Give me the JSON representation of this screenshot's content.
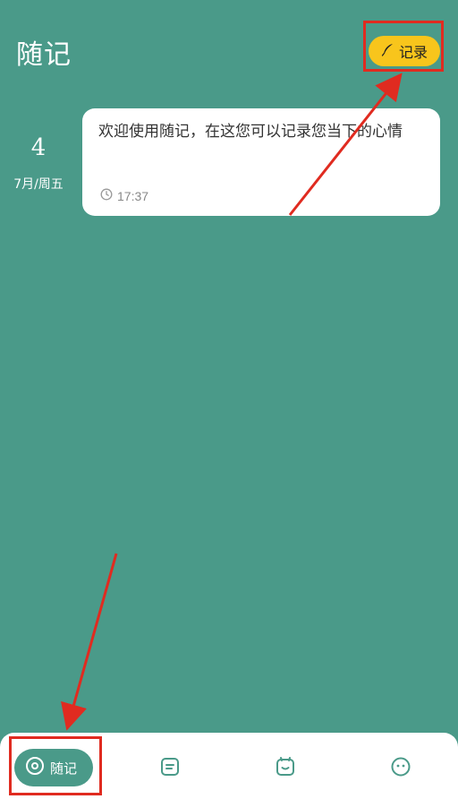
{
  "header": {
    "title": "随记",
    "record_button_label": "记录"
  },
  "entry": {
    "day": "4",
    "month_weekday": "7月/周五",
    "text": "欢迎使用随记，在这您可以记录您当下的心情",
    "time": "17:37"
  },
  "bottom_nav": {
    "items": [
      {
        "label": "随记",
        "icon": "record-icon",
        "active": true
      },
      {
        "label": "",
        "icon": "note-icon",
        "active": false
      },
      {
        "label": "",
        "icon": "mood-icon",
        "active": false
      },
      {
        "label": "",
        "icon": "face-icon",
        "active": false
      }
    ]
  },
  "colors": {
    "background": "#4a9a89",
    "accent": "#f8c51c",
    "annotation": "#e02b20",
    "card": "#ffffff"
  }
}
